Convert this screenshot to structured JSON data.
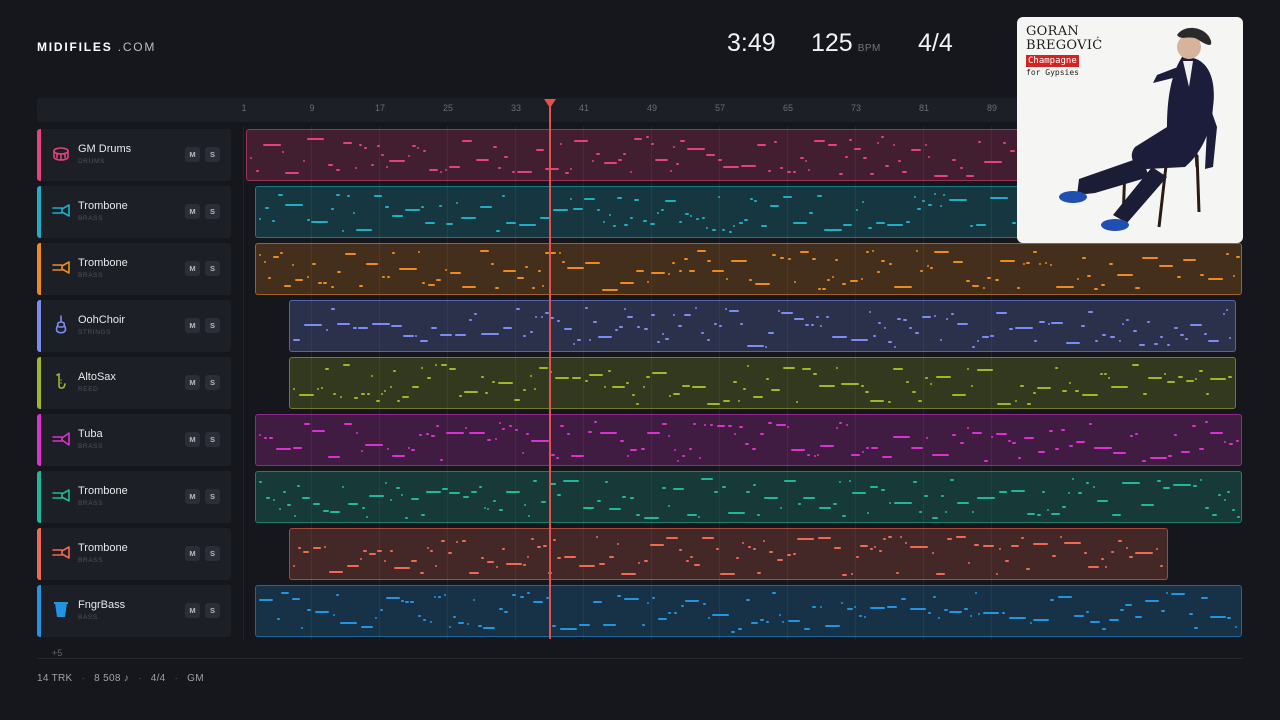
{
  "brand": {
    "name": "MIDIFILES",
    "suffix": ".COM"
  },
  "transport": {
    "time": "3:49",
    "tempo": "125",
    "tempo_unit": "BPM",
    "meter": "4/4"
  },
  "ruler": {
    "bars": [
      "1",
      "9",
      "17",
      "25",
      "33",
      "41",
      "49",
      "57",
      "65",
      "73",
      "81",
      "89"
    ]
  },
  "playhead": {
    "bar": 37
  },
  "album": {
    "artist_line1": "GORAN",
    "artist_line2": "BREGOVIĆ",
    "title": "Champagne",
    "subtitle": "for Gypsies"
  },
  "tracks": [
    {
      "name": "GM Drums",
      "family": "DRUMS",
      "icon": "drum-icon",
      "color": "#e4427c",
      "mute": "M",
      "solo": "S"
    },
    {
      "name": "Trombone",
      "family": "BRASS",
      "icon": "trombone-icon",
      "color": "#21aec4",
      "mute": "M",
      "solo": "S"
    },
    {
      "name": "Trombone",
      "family": "BRASS",
      "icon": "trombone-icon",
      "color": "#ee8a22",
      "mute": "M",
      "solo": "S"
    },
    {
      "name": "OohChoir",
      "family": "STRINGS",
      "icon": "violin-icon",
      "color": "#7c8cf5",
      "mute": "M",
      "solo": "S"
    },
    {
      "name": "AltoSax",
      "family": "REED",
      "icon": "saxophone-icon",
      "color": "#9eb82a",
      "mute": "M",
      "solo": "S"
    },
    {
      "name": "Tuba",
      "family": "BRASS",
      "icon": "tuba-icon",
      "color": "#d932cf",
      "mute": "M",
      "solo": "S"
    },
    {
      "name": "Trombone",
      "family": "BRASS",
      "icon": "trombone-icon",
      "color": "#20b89a",
      "mute": "M",
      "solo": "S"
    },
    {
      "name": "Trombone",
      "family": "BRASS",
      "icon": "trombone-icon",
      "color": "#ef6a50",
      "mute": "M",
      "solo": "S"
    },
    {
      "name": "FngrBass",
      "family": "BASS",
      "icon": "bass-icon",
      "color": "#2294e0",
      "mute": "M",
      "solo": "S"
    }
  ],
  "more_tracks": "+5",
  "footer": {
    "tracks": "14 TRK",
    "notes": "8 508 ♪",
    "meter": "4/4",
    "standard": "GM"
  }
}
